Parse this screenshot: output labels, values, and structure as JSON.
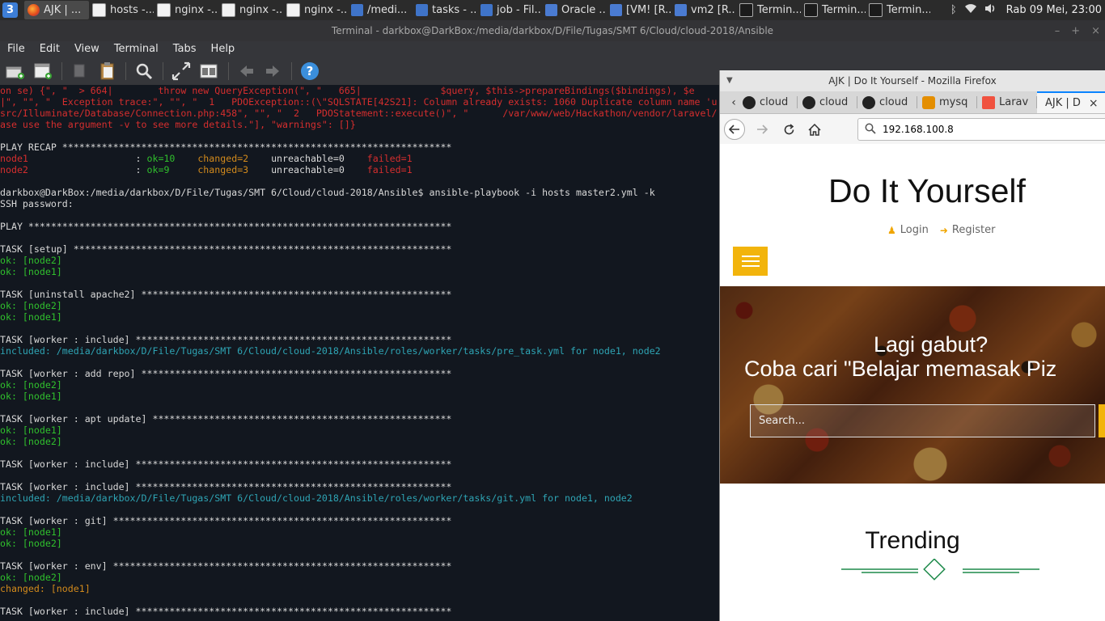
{
  "panel": {
    "start_label": "3",
    "tasks": [
      {
        "label": "AJK | ...",
        "icon": "firefox-icon",
        "active": true
      },
      {
        "label": "hosts -...",
        "icon": "document-icon"
      },
      {
        "label": "nginx -...",
        "icon": "document-icon"
      },
      {
        "label": "nginx -...",
        "icon": "document-icon"
      },
      {
        "label": "nginx -...",
        "icon": "document-icon"
      },
      {
        "label": "/medi...",
        "icon": "folder-icon"
      },
      {
        "label": "tasks - ...",
        "icon": "folder-icon"
      },
      {
        "label": "job - Fil...",
        "icon": "folder-icon"
      },
      {
        "label": "Oracle ...",
        "icon": "virtualbox-icon"
      },
      {
        "label": "[VM! [R...",
        "icon": "virtualbox-icon"
      },
      {
        "label": "vm2 [R...",
        "icon": "virtualbox-icon"
      },
      {
        "label": "Termin...",
        "icon": "terminal-icon"
      },
      {
        "label": "Termin...",
        "icon": "terminal-icon"
      },
      {
        "label": "Termin...",
        "icon": "terminal-icon"
      }
    ],
    "clock": "Rab 09 Mei, 23:00"
  },
  "terminal": {
    "title": "Terminal - darkbox@DarkBox:/media/darkbox/D/File/Tugas/SMT 6/Cloud/cloud-2018/Ansible",
    "menu": [
      "File",
      "Edit",
      "View",
      "Terminal",
      "Tabs",
      "Help"
    ],
    "lines": [
      {
        "t": "on se) {\", \"  > 664|        throw new QueryException(\", \"   665|              $query, $this->prepareBindings($bindings), $e",
        "c": "r"
      },
      {
        "t": "|\", \"\", \"  Exception trace:\", \"\", \"  1   PDOException::(\\\"SQLSTATE[42S21]: Column already exists: 1060 Duplicate column name 'u",
        "c": "r"
      },
      {
        "t": "src/Illuminate/Database/Connection.php:458\", \"\", \"  2   PDOStatement::execute()\", \"      /var/www/web/Hackathon/vendor/laravel/",
        "c": "r"
      },
      {
        "t": "ase use the argument -v to see more details.\"], \"warnings\": []}",
        "c": "r"
      },
      {
        "t": "",
        "c": "w"
      },
      {
        "t": "PLAY RECAP *********************************************************************",
        "c": "w"
      },
      {
        "t": "RECAP1",
        "c": "recap1"
      },
      {
        "t": "RECAP2",
        "c": "recap2"
      },
      {
        "t": "",
        "c": "w"
      },
      {
        "t": "darkbox@DarkBox:/media/darkbox/D/File/Tugas/SMT 6/Cloud/cloud-2018/Ansible$ ansible-playbook -i hosts master2.yml -k",
        "c": "w"
      },
      {
        "t": "SSH password:",
        "c": "w"
      },
      {
        "t": "",
        "c": "w"
      },
      {
        "t": "PLAY ***************************************************************************",
        "c": "w"
      },
      {
        "t": "",
        "c": "w"
      },
      {
        "t": "TASK [setup] *******************************************************************",
        "c": "w"
      },
      {
        "t": "ok: [node2]",
        "c": "g"
      },
      {
        "t": "ok: [node1]",
        "c": "g"
      },
      {
        "t": "",
        "c": "w"
      },
      {
        "t": "TASK [uninstall apache2] *******************************************************",
        "c": "w"
      },
      {
        "t": "ok: [node2]",
        "c": "g"
      },
      {
        "t": "ok: [node1]",
        "c": "g"
      },
      {
        "t": "",
        "c": "w"
      },
      {
        "t": "TASK [worker : include] ********************************************************",
        "c": "w"
      },
      {
        "t": "included: /media/darkbox/D/File/Tugas/SMT 6/Cloud/cloud-2018/Ansible/roles/worker/tasks/pre_task.yml for node1, node2",
        "c": "c"
      },
      {
        "t": "",
        "c": "w"
      },
      {
        "t": "TASK [worker : add repo] *******************************************************",
        "c": "w"
      },
      {
        "t": "ok: [node2]",
        "c": "g"
      },
      {
        "t": "ok: [node1]",
        "c": "g"
      },
      {
        "t": "",
        "c": "w"
      },
      {
        "t": "TASK [worker : apt update] *****************************************************",
        "c": "w"
      },
      {
        "t": "ok: [node1]",
        "c": "g"
      },
      {
        "t": "ok: [node2]",
        "c": "g"
      },
      {
        "t": "",
        "c": "w"
      },
      {
        "t": "TASK [worker : include] ********************************************************",
        "c": "w"
      },
      {
        "t": "",
        "c": "w"
      },
      {
        "t": "TASK [worker : include] ********************************************************",
        "c": "w"
      },
      {
        "t": "included: /media/darkbox/D/File/Tugas/SMT 6/Cloud/cloud-2018/Ansible/roles/worker/tasks/git.yml for node1, node2",
        "c": "c"
      },
      {
        "t": "",
        "c": "w"
      },
      {
        "t": "TASK [worker : git] ************************************************************",
        "c": "w"
      },
      {
        "t": "ok: [node1]",
        "c": "g"
      },
      {
        "t": "ok: [node2]",
        "c": "g"
      },
      {
        "t": "",
        "c": "w"
      },
      {
        "t": "TASK [worker : env] ************************************************************",
        "c": "w"
      },
      {
        "t": "ok: [node2]",
        "c": "g"
      },
      {
        "t": "changed: [node1]",
        "c": "o"
      },
      {
        "t": "",
        "c": "w"
      },
      {
        "t": "TASK [worker : include] ********************************************************",
        "c": "w"
      }
    ],
    "recap": [
      {
        "host": "node1",
        "ok": "ok=10",
        "changed": "changed=2",
        "unreachable": "unreachable=0",
        "failed": "failed=1"
      },
      {
        "host": "node2",
        "ok": "ok=9",
        "changed": "changed=3",
        "unreachable": "unreachable=0",
        "failed": "failed=1"
      }
    ]
  },
  "firefox": {
    "title": "AJK | Do It Yourself - Mozilla Firefox",
    "tabs": [
      {
        "label": "cloud",
        "icon": "github-icon"
      },
      {
        "label": "cloud",
        "icon": "github-icon"
      },
      {
        "label": "cloud",
        "icon": "github-icon"
      },
      {
        "label": "mysq",
        "icon": "mysql-icon"
      },
      {
        "label": "Larav",
        "icon": "laravel-icon"
      },
      {
        "label": "AJK | D",
        "icon": "",
        "active": true
      }
    ],
    "url": "192.168.100.8",
    "page": {
      "site_title": "Do It Yourself",
      "login": "Login",
      "register": "Register",
      "hero_line1": "Lagi gabut?",
      "hero_line2": "Coba cari \"Belajar memasak Piz",
      "search_placeholder": "Search...",
      "trending": "Trending"
    },
    "accent": "#f2b40c",
    "trend_color": "#1e8a4a"
  }
}
